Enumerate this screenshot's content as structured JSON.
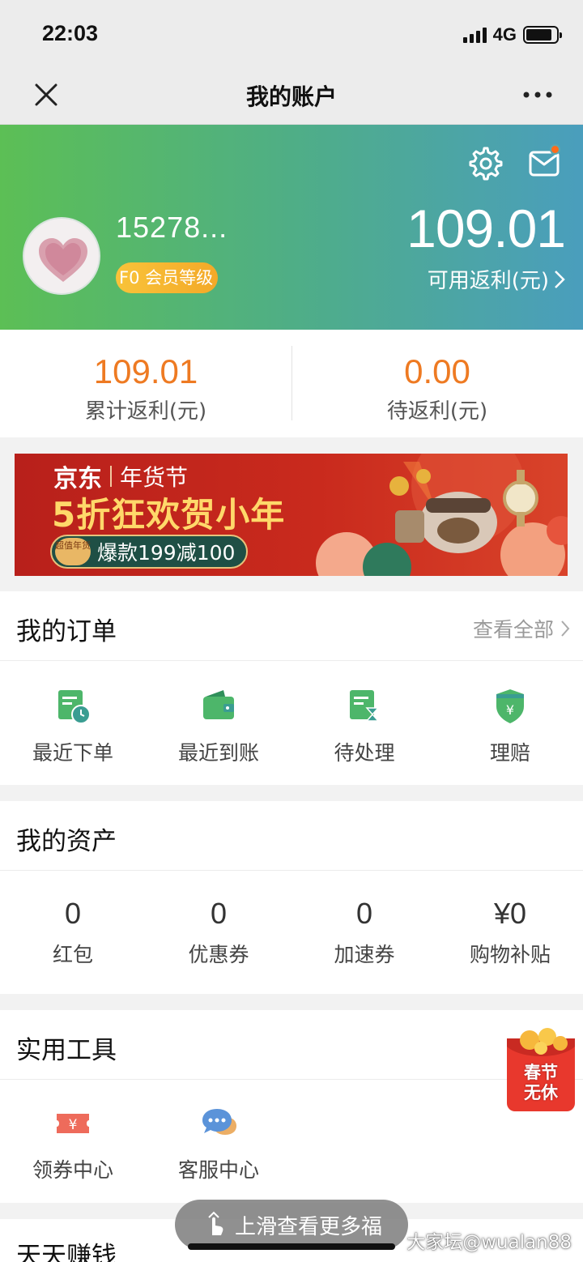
{
  "status_bar": {
    "time": "22:03",
    "network": "4G"
  },
  "nav": {
    "title": "我的账户"
  },
  "account": {
    "phone": "15278...",
    "member_badge": "F0 会员等级",
    "balance_value": "109.01",
    "balance_label": "可用返利(元)",
    "accent_color": "#ee7a22",
    "notification_dot_color": "#ff6b1a"
  },
  "summary": [
    {
      "value": "109.01",
      "label": "累计返利(元)"
    },
    {
      "value": "0.00",
      "label": "待返利(元)"
    }
  ],
  "banner": {
    "brand": "京东",
    "event": "年货节",
    "headline": "5折狂欢贺小年",
    "tag": "超值年货",
    "promo": "爆款199减100"
  },
  "orders": {
    "title": "我的订单",
    "view_all": "查看全部",
    "items": [
      {
        "label": "最近下单",
        "icon": "recent-order-icon"
      },
      {
        "label": "最近到账",
        "icon": "wallet-icon"
      },
      {
        "label": "待处理",
        "icon": "pending-icon"
      },
      {
        "label": "理赔",
        "icon": "shield-yen-icon"
      }
    ]
  },
  "assets": {
    "title": "我的资产",
    "items": [
      {
        "value": "0",
        "label": "红包"
      },
      {
        "value": "0",
        "label": "优惠券"
      },
      {
        "value": "0",
        "label": "加速券"
      },
      {
        "value": "¥0",
        "label": "购物补贴"
      }
    ]
  },
  "tools": {
    "title": "实用工具",
    "items": [
      {
        "label": "领券中心",
        "icon": "coupon-icon"
      },
      {
        "label": "客服中心",
        "icon": "chat-bubble-icon"
      }
    ]
  },
  "spring_badge": "春节无休",
  "next_section": {
    "title": "天天赚钱"
  },
  "swipe_hint": "上滑查看更多福",
  "watermark": "大家坛@wualan88"
}
